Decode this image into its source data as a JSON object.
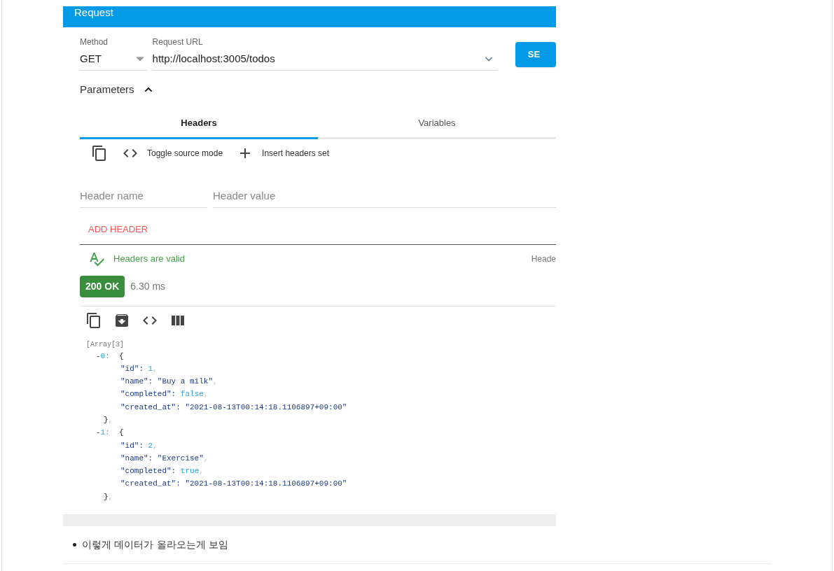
{
  "request": {
    "title": "Request",
    "method": {
      "label": "Method",
      "value": "GET"
    },
    "url": {
      "label": "Request URL",
      "value": "http://localhost:3005/todos"
    },
    "send_button": "SE",
    "parameters": {
      "label": "Parameters",
      "expanded": true
    },
    "tabs": [
      {
        "label": "Headers",
        "selected": true
      },
      {
        "label": "Variables",
        "selected": false
      }
    ],
    "toolbar": [
      {
        "kind": "copy"
      },
      {
        "kind": "code",
        "label": "Toggle source mode"
      },
      {
        "kind": "add",
        "label": "Insert headers set"
      }
    ],
    "header_name": {
      "placeholder": "Header name"
    },
    "header_value": {
      "placeholder": "Header value"
    },
    "add_header": "ADD HEADER",
    "validation": "Headers are valid",
    "side_label": "Heade"
  },
  "response": {
    "status": "200 OK",
    "time": "6.30 ms",
    "toolbar": [
      {
        "kind": "copy"
      },
      {
        "kind": "save"
      },
      {
        "kind": "code"
      },
      {
        "kind": "columns"
      }
    ],
    "array_label": "[Array[3]",
    "lines": [
      {
        "kind": "open",
        "parts": [
          {
            "kind": "plain",
            "text": "-"
          },
          {
            "kind": "number",
            "text": "0:"
          },
          {
            "kind": "plain",
            "text": "  {"
          }
        ]
      },
      {
        "kind": "field",
        "parts": [
          {
            "kind": "key",
            "text": "\"id\": "
          },
          {
            "kind": "number",
            "text": "1"
          },
          {
            "kind": "punct",
            "text": ","
          }
        ]
      },
      {
        "kind": "field",
        "parts": [
          {
            "kind": "key",
            "text": "\"name\": "
          },
          {
            "kind": "string",
            "text": "\"Buy a milk\""
          },
          {
            "kind": "punct",
            "text": ","
          }
        ]
      },
      {
        "kind": "field",
        "parts": [
          {
            "kind": "key",
            "text": "\"completed\": "
          },
          {
            "kind": "number",
            "text": "false"
          },
          {
            "kind": "punct",
            "text": ","
          }
        ]
      },
      {
        "kind": "field",
        "parts": [
          {
            "kind": "key",
            "text": "\"created_at\": "
          },
          {
            "kind": "string",
            "text": "\"2021-08-13T00:14:18.1106897+09:00\""
          }
        ]
      },
      {
        "kind": "close",
        "parts": [
          {
            "kind": "plain",
            "text": "}"
          },
          {
            "kind": "punct",
            "text": ","
          }
        ]
      },
      {
        "kind": "open",
        "parts": [
          {
            "kind": "plain",
            "text": "-"
          },
          {
            "kind": "number",
            "text": "1:"
          },
          {
            "kind": "plain",
            "text": "  {"
          }
        ]
      },
      {
        "kind": "field",
        "parts": [
          {
            "kind": "key",
            "text": "\"id\": "
          },
          {
            "kind": "number",
            "text": "2"
          },
          {
            "kind": "punct",
            "text": ","
          }
        ]
      },
      {
        "kind": "field",
        "parts": [
          {
            "kind": "key",
            "text": "\"name\": "
          },
          {
            "kind": "string",
            "text": "\"Exercise\""
          },
          {
            "kind": "punct",
            "text": ","
          }
        ]
      },
      {
        "kind": "field",
        "parts": [
          {
            "kind": "key",
            "text": "\"completed\": "
          },
          {
            "kind": "number",
            "text": "true"
          },
          {
            "kind": "punct",
            "text": ","
          }
        ]
      },
      {
        "kind": "field",
        "parts": [
          {
            "kind": "key",
            "text": "\"created_at\": "
          },
          {
            "kind": "string",
            "text": "\"2021-08-13T00:14:18.1106897+09:00\""
          }
        ]
      },
      {
        "kind": "close",
        "parts": [
          {
            "kind": "plain",
            "text": "}"
          },
          {
            "kind": "punct",
            "text": ","
          }
        ]
      }
    ]
  },
  "bullets": [
    "이렇게 데이터가 올라오는게 보임"
  ]
}
